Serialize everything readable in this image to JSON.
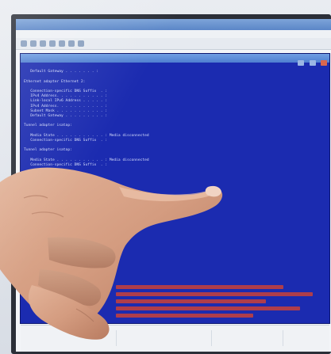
{
  "photo": {
    "description_free": true
  },
  "top_label": "",
  "app": {
    "title": "",
    "menu": [
      "",
      "",
      "",
      "",
      "",
      ""
    ]
  },
  "console": {
    "title": "",
    "lines": [
      "",
      "   Default Gateway . . . . . . . :",
      "",
      "Ethernet adapter Ethernet 2:",
      "",
      "   Connection-specific DNS Suffix  . :",
      "   IPv4 Address. . . . . . . . . . . :",
      "   Link-local IPv6 Address . . . . . :",
      "   IPv4 Address. . . . . . . . . . . :",
      "   Subnet Mask . . . . . . . . . . . :",
      "   Default Gateway . . . . . . . . . :",
      "",
      "Tunnel adapter isatap:",
      "",
      "   Media State . . . . . . . . . . . : Media disconnected",
      "   Connection-specific DNS Suffix  . :",
      "",
      "Tunnel adapter isatap:",
      "",
      "   Media State . . . . . . . . . . . : Media disconnected",
      "   Connection-specific DNS Suffix  . :"
    ]
  },
  "colors": {
    "console_bg": "#1b2bb0",
    "console_text": "#d7defc",
    "highlight_red": "#c8413a",
    "window_chrome": "#5b86c7"
  }
}
